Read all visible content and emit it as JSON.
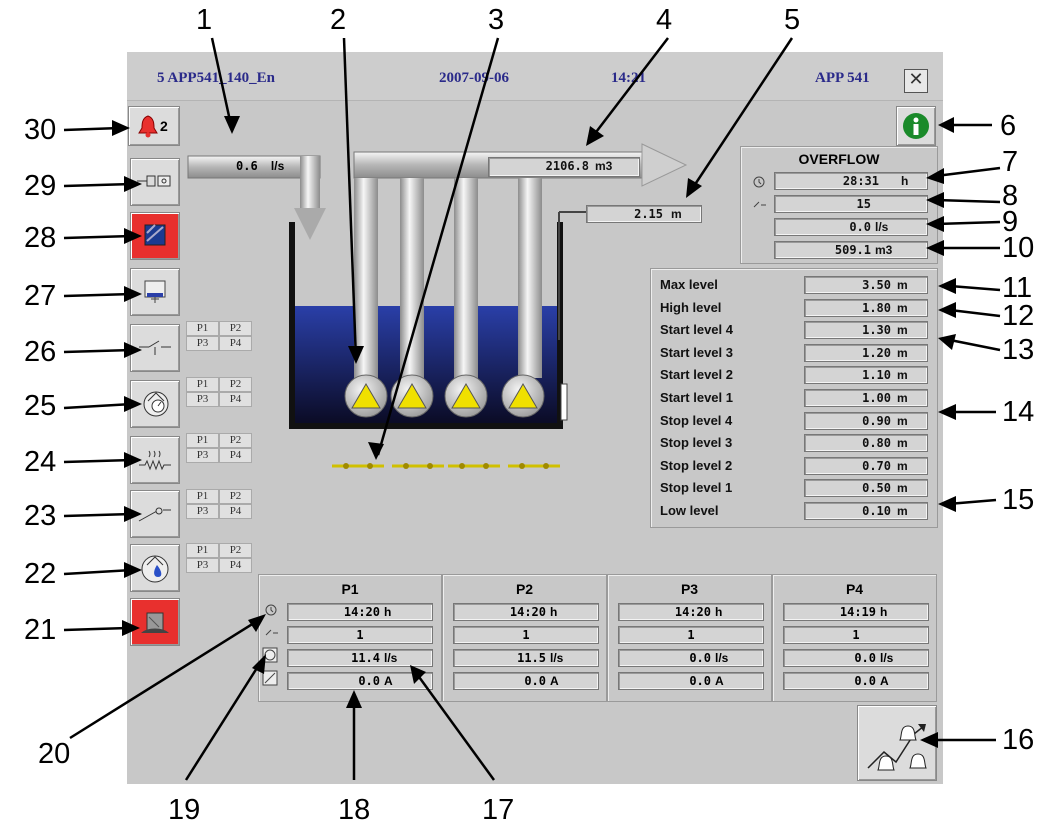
{
  "header": {
    "station": "5  APP541_140_En",
    "date": "2007-09-06",
    "time": "14:21",
    "model": "APP 541",
    "close_symbol": "✕"
  },
  "alarm_count": "2",
  "inflow": {
    "value": "0.6",
    "unit": "l/s"
  },
  "pumped_volume": {
    "value": "2106.8",
    "unit": "m3"
  },
  "current_level": {
    "value": "2.15",
    "unit": "m"
  },
  "overflow": {
    "title": "OVERFLOW",
    "time": {
      "value": "28:31",
      "unit": "h"
    },
    "count": {
      "value": "15"
    },
    "flow": {
      "value": "0.0",
      "unit": "l/s"
    },
    "volume": {
      "value": "509.1",
      "unit": "m3"
    }
  },
  "levels": [
    {
      "label": "Max level",
      "value": "3.50",
      "unit": "m"
    },
    {
      "label": "High level",
      "value": "1.80",
      "unit": "m"
    },
    {
      "label": "Start level 4",
      "value": "1.30",
      "unit": "m"
    },
    {
      "label": "Start level 3",
      "value": "1.20",
      "unit": "m"
    },
    {
      "label": "Start level 2",
      "value": "1.10",
      "unit": "m"
    },
    {
      "label": "Start level 1",
      "value": "1.00",
      "unit": "m"
    },
    {
      "label": "Stop level 4",
      "value": "0.90",
      "unit": "m"
    },
    {
      "label": "Stop level 3",
      "value": "0.80",
      "unit": "m"
    },
    {
      "label": "Stop level 2",
      "value": "0.70",
      "unit": "m"
    },
    {
      "label": "Stop level 1",
      "value": "0.50",
      "unit": "m"
    },
    {
      "label": "Low level",
      "value": "0.10",
      "unit": "m"
    }
  ],
  "pump_selectors": {
    "p1": "P1",
    "p2": "P2",
    "p3": "P3",
    "p4": "P4"
  },
  "pumps": [
    {
      "name": "P1",
      "runtime": "14:20",
      "runtime_unit": "h",
      "starts": "1",
      "flow": "11.4",
      "flow_unit": "l/s",
      "current": "0.0",
      "current_unit": "A"
    },
    {
      "name": "P2",
      "runtime": "14:20",
      "runtime_unit": "h",
      "starts": "1",
      "flow": "11.5",
      "flow_unit": "l/s",
      "current": "0.0",
      "current_unit": "A"
    },
    {
      "name": "P3",
      "runtime": "14:20",
      "runtime_unit": "h",
      "starts": "1",
      "flow": "0.0",
      "flow_unit": "l/s",
      "current": "0.0",
      "current_unit": "A"
    },
    {
      "name": "P4",
      "runtime": "14:19",
      "runtime_unit": "h",
      "starts": "1",
      "flow": "0.0",
      "flow_unit": "l/s",
      "current": "0.0",
      "current_unit": "A"
    }
  ],
  "callouts": [
    "1",
    "2",
    "3",
    "4",
    "5",
    "6",
    "7",
    "8",
    "9",
    "10",
    "11",
    "12",
    "13",
    "14",
    "15",
    "16",
    "17",
    "18",
    "19",
    "20",
    "21",
    "22",
    "23",
    "24",
    "25",
    "26",
    "27",
    "28",
    "29",
    "30"
  ],
  "colors": {
    "panel": "#c8c8c8",
    "title_text": "#2a2a8a",
    "alarm_red": "#e8302e",
    "water_top": "#2a3fa8",
    "water_bottom": "#0a0a22",
    "pump_yellow": "#f0e000",
    "info_green": "#1a8a2a"
  }
}
